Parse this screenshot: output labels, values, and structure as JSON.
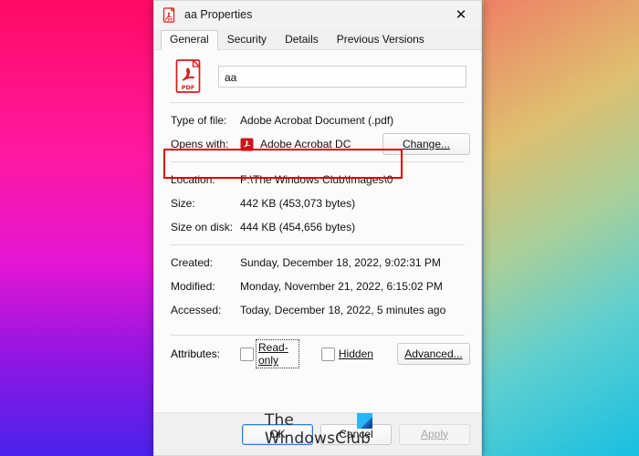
{
  "window": {
    "title": "aa Properties",
    "title_icon": "pdf-document-icon",
    "close_label": "✕"
  },
  "tabs": [
    {
      "label": "General",
      "active": true
    },
    {
      "label": "Security",
      "active": false
    },
    {
      "label": "Details",
      "active": false
    },
    {
      "label": "Previous Versions",
      "active": false
    }
  ],
  "general": {
    "file_icon": "pdf-file-icon",
    "filename_value": "aa",
    "filename_placeholder": "",
    "type_of_file_label": "Type of file:",
    "type_of_file_value": "Adobe Acrobat Document (.pdf)",
    "opens_with_label": "Opens with:",
    "opens_with_value": "Adobe Acrobat DC",
    "opens_with_icon": "adobe-acrobat-icon",
    "change_button": "Change...",
    "location_label": "Location:",
    "location_value": "F:\\The Windows Club\\Images\\0",
    "size_label": "Size:",
    "size_value": "442 KB (453,073 bytes)",
    "size_on_disk_label": "Size on disk:",
    "size_on_disk_value": "444 KB (454,656 bytes)",
    "created_label": "Created:",
    "created_value": "Sunday, December 18, 2022, 9:02:31 PM",
    "modified_label": "Modified:",
    "modified_value": "Monday, November 21, 2022, 6:15:02 PM",
    "accessed_label": "Accessed:",
    "accessed_value": "Today, December 18, 2022, 5 minutes ago",
    "attributes_label": "Attributes:",
    "readonly_label": "Read-only",
    "readonly_checked": false,
    "hidden_label": "Hidden",
    "hidden_checked": false,
    "advanced_button": "Advanced..."
  },
  "highlight": {
    "color": "#e00000",
    "target": "type-of-file-row"
  },
  "watermark": {
    "line1": "The",
    "line2": "WindowsClub",
    "mark_color": "#29b6f6"
  },
  "footer": {
    "ok_label": "OK",
    "cancel_label": "Cancel",
    "apply_label": "Apply",
    "apply_enabled": false
  },
  "theme": {
    "accent_focus": "#2a7fd4",
    "window_bg": "#f0f0f0",
    "page_bg": "#fbfbfb",
    "pdf_red": "#d71b1b"
  }
}
